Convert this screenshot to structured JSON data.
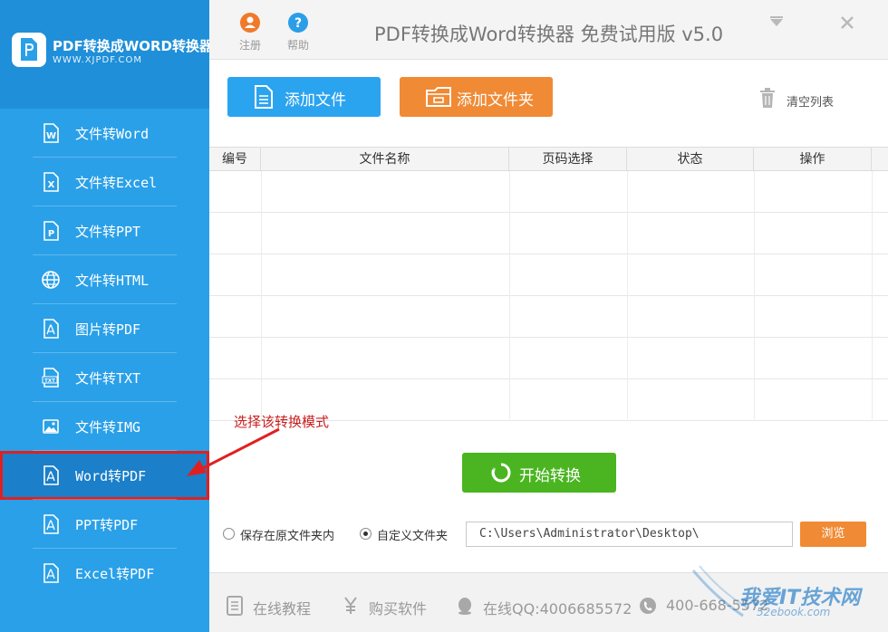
{
  "brand": {
    "title": "PDF转换成WORD转换器",
    "url": "WWW.XJPDF.COM"
  },
  "sidebar": {
    "items": [
      {
        "label": "文件转Word",
        "icon": "word-doc-icon"
      },
      {
        "label": "文件转Excel",
        "icon": "excel-doc-icon"
      },
      {
        "label": "文件转PPT",
        "icon": "ppt-doc-icon"
      },
      {
        "label": "文件转HTML",
        "icon": "globe-icon"
      },
      {
        "label": "图片转PDF",
        "icon": "pdf-doc-icon"
      },
      {
        "label": "文件转TXT",
        "icon": "txt-doc-icon"
      },
      {
        "label": "文件转IMG",
        "icon": "image-icon"
      },
      {
        "label": "Word转PDF",
        "icon": "pdf-doc-icon",
        "active": true
      },
      {
        "label": "PPT转PDF",
        "icon": "pdf-doc-icon"
      },
      {
        "label": "Excel转PDF",
        "icon": "pdf-doc-icon"
      }
    ]
  },
  "topbar": {
    "register": "注册",
    "help": "帮助",
    "title": "PDF转换成Word转换器 免费试用版 v5.0"
  },
  "toolbar": {
    "add_file": "添加文件",
    "add_folder": "添加文件夹",
    "clear_list": "清空列表"
  },
  "table": {
    "columns": [
      "编号",
      "文件名称",
      "页码选择",
      "状态",
      "操作"
    ]
  },
  "annotation": "选择该转换模式",
  "actions": {
    "start": "开始转换"
  },
  "save": {
    "option_original": "保存在原文件夹内",
    "option_custom": "自定义文件夹",
    "selected": "custom",
    "path": "C:\\Users\\Administrator\\Desktop\\",
    "browse": "浏览"
  },
  "footer": {
    "tutorial": "在线教程",
    "buy": "购买软件",
    "qq": "在线QQ:4006685572",
    "phone": "400-668-5572"
  },
  "watermark": {
    "text": "我爱IT技术网",
    "sub": "52ebook.com"
  },
  "colors": {
    "sidebar": "#2aa0e8",
    "active": "#1b7fc9",
    "highlight": "#e02020",
    "blue_button": "#2ba4f0",
    "orange_button": "#f08a34",
    "green_button": "#4ab520"
  }
}
